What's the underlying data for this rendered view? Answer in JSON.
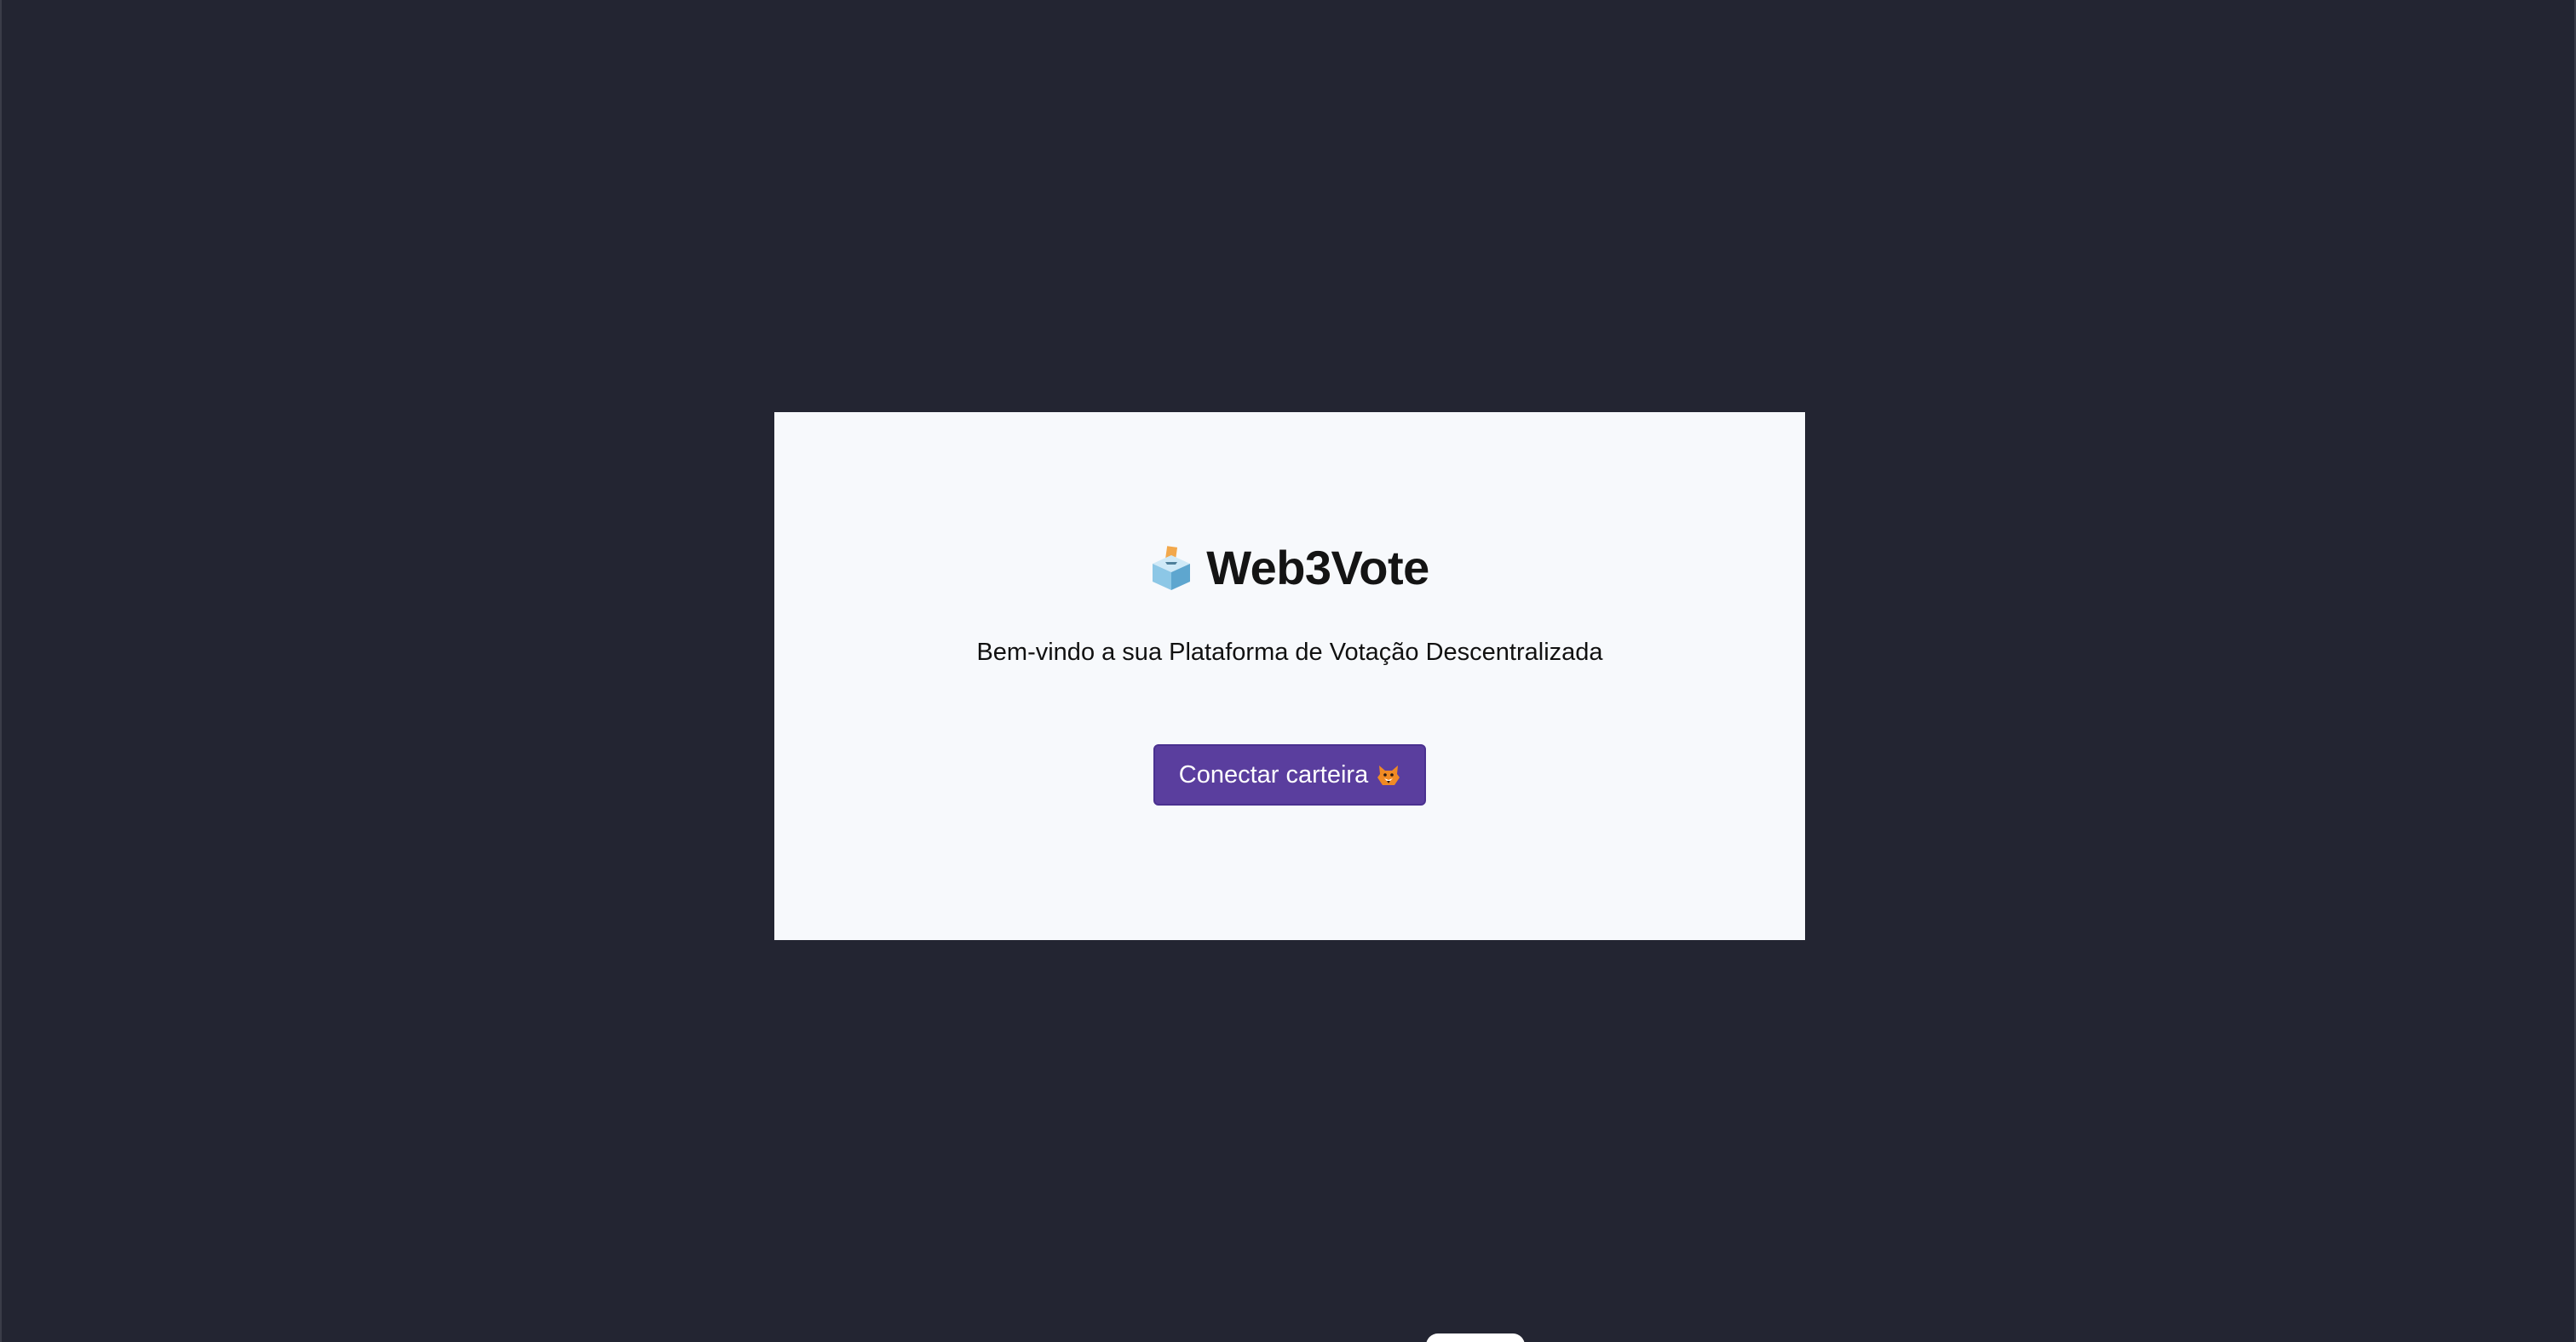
{
  "app": {
    "title": "Web3Vote",
    "title_icon": "ballot-box-icon",
    "subtitle": "Bem-vindo a sua Plataforma de Votação Descentralizada"
  },
  "actions": {
    "connect_label": "Conectar carteira",
    "connect_icon": "fox-icon"
  },
  "colors": {
    "background": "#232532",
    "card": "#f7f9fc",
    "button": "#5a3e9e",
    "button_text": "#ffffff",
    "title_text": "#141414"
  }
}
